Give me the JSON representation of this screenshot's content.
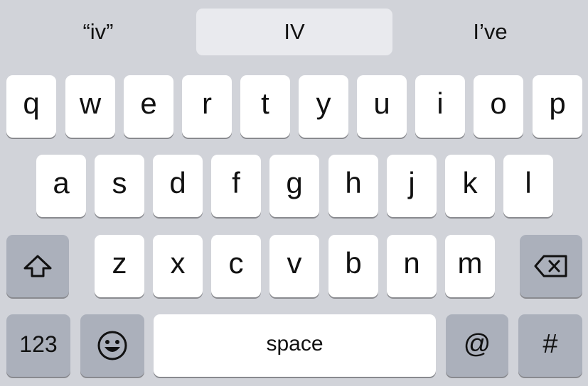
{
  "suggestions": [
    "“iv”",
    "IV",
    "I’ve"
  ],
  "keyboard": {
    "row1": [
      "q",
      "w",
      "e",
      "r",
      "t",
      "y",
      "u",
      "i",
      "o",
      "p"
    ],
    "row2": [
      "a",
      "s",
      "d",
      "f",
      "g",
      "h",
      "j",
      "k",
      "l"
    ],
    "row3": [
      "z",
      "x",
      "c",
      "v",
      "b",
      "n",
      "m"
    ],
    "shift_icon": "shift-arrow-icon",
    "delete_icon": "backspace-icon",
    "numbers_label": "123",
    "emoji_icon": "emoji-smiley-icon",
    "space_label": "space",
    "at_label": "@",
    "hash_label": "#"
  },
  "colors": {
    "background": "#d1d3d9",
    "key": "#ffffff",
    "special_key": "#abb0bb",
    "selected_suggestion": "#e9eaee"
  }
}
